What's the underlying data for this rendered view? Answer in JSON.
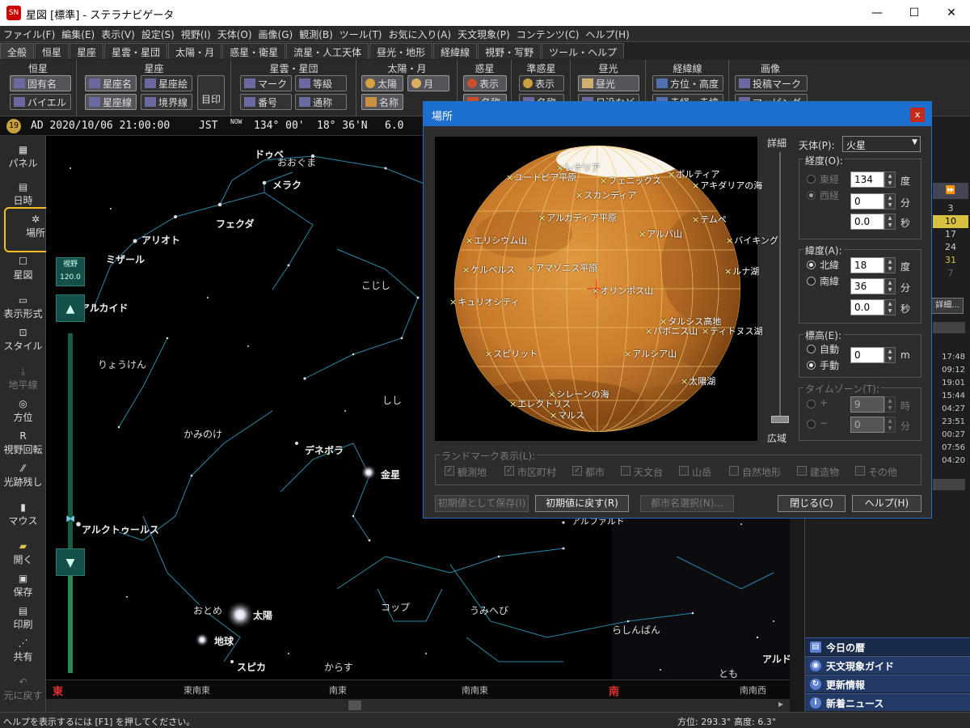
{
  "window": {
    "title": "星図 [標準] - ステラナビゲータ",
    "icon_text": "SN",
    "controls": [
      "—",
      "☐",
      "✕"
    ]
  },
  "menu": [
    "ファイル(F)",
    "編集(E)",
    "表示(V)",
    "設定(S)",
    "視野(I)",
    "天体(O)",
    "画像(G)",
    "観測(B)",
    "ツール(T)",
    "お気に入り(A)",
    "天文現象(P)",
    "コンテンツ(C)",
    "ヘルプ(H)"
  ],
  "tabs": [
    "全般",
    "恒星",
    "星座",
    "星雲・星団",
    "太陽・月",
    "惑星・衛星",
    "流星・人工天体",
    "昼光・地形",
    "経緯線",
    "視野・写野",
    "ツール・ヘルプ"
  ],
  "ribbon": {
    "groups": [
      "恒星",
      "星座",
      "星雲・星団",
      "太陽・月",
      "惑星",
      "準惑星",
      "昼光",
      "経緯線",
      "画像"
    ],
    "buttons": {
      "star_proper_name": "固有名",
      "star_bayer": "バイエル",
      "const_name": "星座名",
      "const_picture": "星座絵",
      "const_lines": "星座線",
      "const_boundary": "境界線",
      "const_mark": "目印",
      "neb_mark": "マーク",
      "neb_mag": "等級",
      "neb_number": "番号",
      "neb_common": "通称",
      "sun": "太陽",
      "moon": "月",
      "sunmoon_name": "名称",
      "planet_show": "表示",
      "planet_name": "名称",
      "dwarf_show": "表示",
      "dwarf_name": "名称",
      "daylight": "昼光",
      "daylight_2": "日没など",
      "grid_altaz": "方位・高度",
      "grid_radec": "赤経・赤緯",
      "img_post": "投稿マーク",
      "img_map": "マッピング"
    }
  },
  "status_row": {
    "moon_age": "19",
    "datetime": "AD 2020/10/06 21:00:00",
    "tz": "JST",
    "now": "NOW",
    "lon": "134° 00'",
    "lat": "18° 36'N",
    "mag": "6.0"
  },
  "left_panel": [
    "パネル",
    "日時",
    "場所",
    "星図",
    "表示形式",
    "スタイル",
    "地平線",
    "方位",
    "視野回転",
    "光跡残し",
    "マウス",
    "開く",
    "保存",
    "印刷",
    "共有",
    "元に戻す"
  ],
  "zoom": {
    "label": "視野",
    "value": "120.0"
  },
  "sky_labels": {
    "constellations": [
      "おおぐま",
      "こじし",
      "りょうけん",
      "かみのけ",
      "しし",
      "おとめ",
      "コップ",
      "うみへび",
      "らしんばん",
      "からす",
      "とも"
    ],
    "stars": [
      "ドゥベ",
      "メラク",
      "フェクダ",
      "アリオト",
      "ミザール",
      "アルカイド",
      "デネボラ",
      "アルクトゥールス",
      "スピカ",
      "アルファルド",
      "アルドラ"
    ],
    "bodies": [
      "金星",
      "太陽",
      "地球"
    ]
  },
  "horizon": [
    "東",
    "東南東",
    "南東",
    "南南東",
    "南",
    "南南西"
  ],
  "statusbar": {
    "help": "ヘルプを表示するには [F1] を押してください。",
    "azimuth": "方位: 293.3°",
    "altitude": "高度: 6.3°"
  },
  "right_panel": {
    "calendar_nums": [
      "3",
      "10",
      "17",
      "24",
      "31",
      "7"
    ],
    "times": [
      "17:48",
      "09:12",
      "19:01",
      "15:44",
      "04:27",
      "23:51",
      "00:27",
      "07:56",
      "04:20"
    ],
    "detail_button": "詳細...",
    "items": [
      "今日の暦",
      "天文現象ガイド",
      "更新情報",
      "新着ニュース"
    ]
  },
  "dialog": {
    "title": "場所",
    "close": "x",
    "detail_label": "詳細",
    "wide_label": "広域",
    "body_label": "天体(P):",
    "body_value": "火星",
    "longitude": {
      "label": "経度(O):",
      "east": "東経",
      "west": "西経",
      "deg": "134",
      "min": "0",
      "sec": "0.0",
      "u_deg": "度",
      "u_min": "分",
      "u_sec": "秒"
    },
    "latitude": {
      "label": "緯度(A):",
      "north": "北緯",
      "south": "南緯",
      "deg": "18",
      "min": "36",
      "sec": "0.0",
      "u_deg": "度",
      "u_min": "分",
      "u_sec": "秒"
    },
    "altitude": {
      "label": "標高(E):",
      "auto": "自動",
      "manual": "手動",
      "value": "0",
      "unit": "m"
    },
    "timezone": {
      "label": "タイムゾーン(T):",
      "plus": "+",
      "minus": "−",
      "hour": "9",
      "min": "0",
      "u_hour": "時",
      "u_min": "分"
    },
    "landmark": {
      "label": "ランドマーク表示(L):",
      "items": [
        "観測地",
        "市区町村",
        "都市",
        "天文台",
        "山岳",
        "自然地形",
        "建造物",
        "その他"
      ]
    },
    "buttons": {
      "save_default": "初期値として保存(I)",
      "reset": "初期値に戻す(R)",
      "city_select": "都市名選択(N)...",
      "close": "閉じる(C)",
      "help": "ヘルプ(H)"
    },
    "mars_labels": [
      "ユートピア平原",
      "レナリア",
      "フェニックス",
      "ボルティア",
      "アキダリアの海",
      "スカンディア",
      "アルカディア平原",
      "テムペ",
      "アルバ山",
      "エリシウム山",
      "バイキング",
      "ケルベルス",
      "アマゾニス平原",
      "ルナ湖",
      "オリンポス山",
      "キュリオシティ",
      "タルシス高地",
      "パボニス山",
      "ティトヌス湖",
      "スピリット",
      "アルシア山",
      "太陽湖",
      "シレーンの海",
      "エレクトリス",
      "マルス"
    ]
  }
}
